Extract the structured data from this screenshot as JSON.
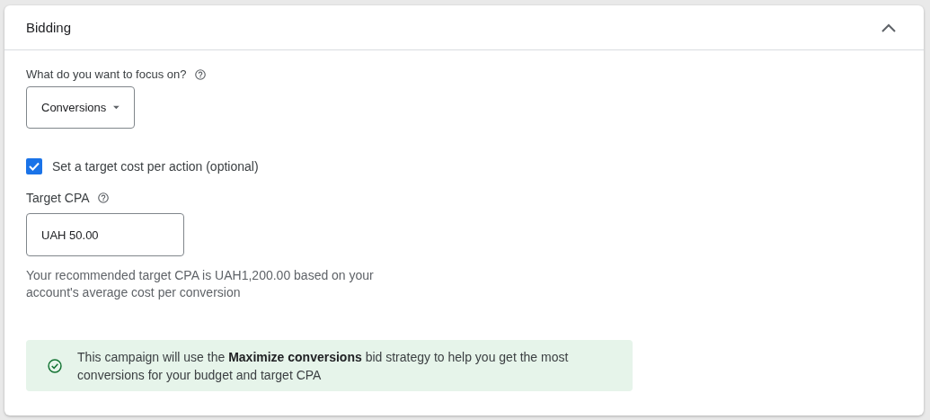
{
  "card": {
    "title": "Bidding",
    "expanded": true
  },
  "focus": {
    "label": "What do you want to focus on?",
    "value": "Conversions"
  },
  "target_checkbox": {
    "label": "Set a target cost per action (optional)",
    "checked": true
  },
  "target_cpa": {
    "label": "Target CPA",
    "value": "UAH 50.00",
    "hint": "Your recommended target CPA is UAH1,200.00 based on your account's average cost per conversion"
  },
  "notice": {
    "text": "This campaign will use the **Maximize conversions** bid strategy to help you get the most conversions for your budget and target CPA"
  }
}
